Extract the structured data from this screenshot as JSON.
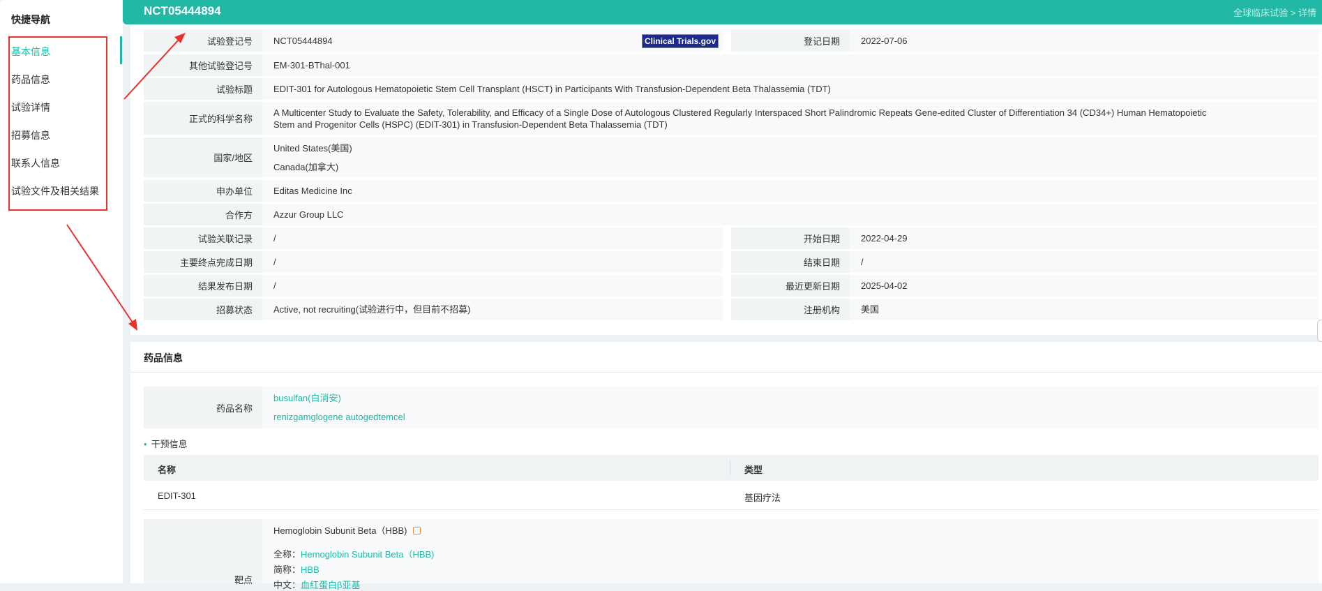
{
  "sidebar": {
    "title": "快捷导航",
    "items": [
      {
        "label": "基本信息",
        "active": true
      },
      {
        "label": "药品信息"
      },
      {
        "label": "试验详情"
      },
      {
        "label": "招募信息"
      },
      {
        "label": "联系人信息"
      },
      {
        "label": "试验文件及相关结果"
      }
    ]
  },
  "header": {
    "title": "NCT05444894",
    "breadcrumb": {
      "parent": "全球临床试验",
      "separator": ">",
      "current": "详情"
    }
  },
  "basic": {
    "reg_no": {
      "label": "试验登记号",
      "value": "NCT05444894"
    },
    "badge": "Clinical Trials.gov",
    "reg_date": {
      "label": "登记日期",
      "value": "2022-07-06"
    },
    "other_reg_no": {
      "label": "其他试验登记号",
      "value": "EM-301-BThal-001"
    },
    "trial_title": {
      "label": "试验标题",
      "value": "EDIT-301 for Autologous Hematopoietic Stem Cell Transplant (HSCT) in Participants With Transfusion-Dependent Beta Thalassemia (TDT)"
    },
    "sci_name": {
      "label": "正式的科学名称",
      "value_line1": "A Multicenter Study to Evaluate the Safety, Tolerability, and Efficacy of a Single Dose of Autologous Clustered Regularly Interspaced Short Palindromic Repeats Gene-edited Cluster of Differentiation 34 (CD34+) Human Hematopoietic",
      "value_line2": "Stem and Progenitor Cells (HSPC) (EDIT-301) in Transfusion-Dependent Beta Thalassemia (TDT)"
    },
    "country": {
      "label": "国家/地区",
      "values": [
        "United States(美国)",
        "Canada(加拿大)"
      ]
    },
    "sponsor": {
      "label": "申办单位",
      "value": "Editas Medicine Inc"
    },
    "collaborator": {
      "label": "合作方",
      "value": "Azzur Group LLC"
    },
    "related_record": {
      "label": "试验关联记录",
      "value": "/"
    },
    "start_date": {
      "label": "开始日期",
      "value": "2022-04-29"
    },
    "primary_completion": {
      "label": "主要终点完成日期",
      "value": "/"
    },
    "end_date": {
      "label": "结束日期",
      "value": "/"
    },
    "result_date": {
      "label": "结果发布日期",
      "value": "/"
    },
    "last_update": {
      "label": "最近更新日期",
      "value": "2025-04-02"
    },
    "recruit_status": {
      "label": "招募状态",
      "value": "Active, not recruiting(试验进行中，但目前不招募)"
    },
    "registry": {
      "label": "注册机构",
      "value": "美国"
    }
  },
  "drug": {
    "section_title": "药品信息",
    "name_label": "药品名称",
    "names": [
      "busulfan(白消安)",
      "renizgamglogene autogedtemcel"
    ],
    "intervention_title": "干预信息",
    "table": {
      "headers": [
        "名称",
        "类型"
      ],
      "rows": [
        [
          "EDIT-301",
          "基因疗法"
        ]
      ]
    },
    "target": {
      "label": "靶点",
      "name": "Hemoglobin Subunit Beta（HBB)",
      "full_label": "全称：",
      "full_value": "Hemoglobin Subunit Beta（HBB)",
      "short_label": "简称：",
      "short_value": "HBB",
      "cn_label": "中文：",
      "cn_value": "血红蛋白β亚基"
    }
  },
  "colors": {
    "accent": "#21b8a6",
    "annotation": "#e8322b"
  }
}
